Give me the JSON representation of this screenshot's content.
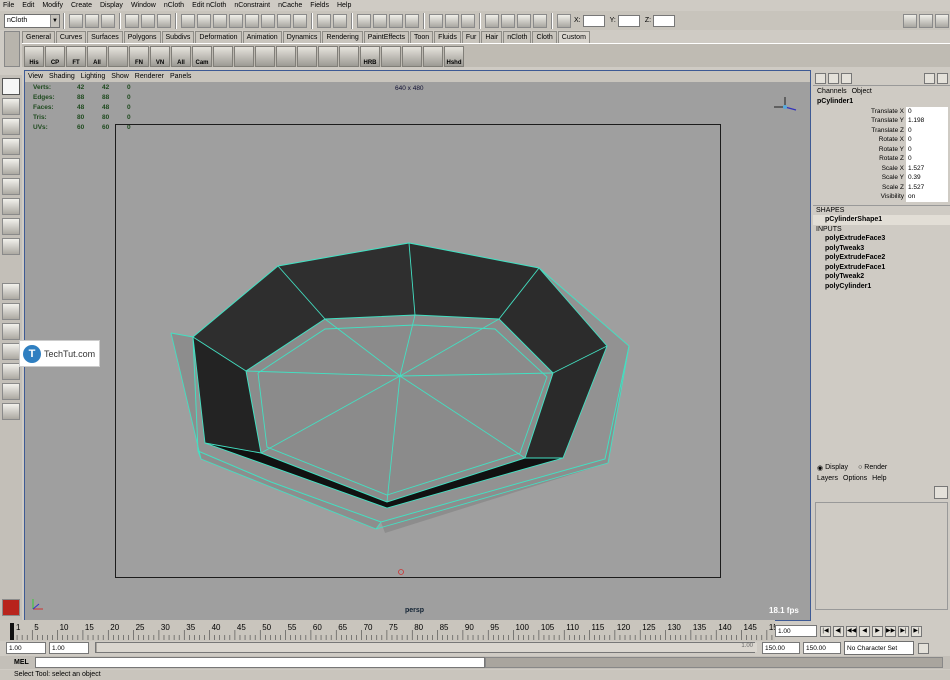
{
  "menubar": [
    "File",
    "Edit",
    "Modify",
    "Create",
    "Display",
    "Window",
    "nCloth",
    "Edit nCloth",
    "nConstraint",
    "nCache",
    "Fields",
    "Help"
  ],
  "statusline": {
    "menuset": "nCloth",
    "x_label": "X:",
    "y_label": "Y:",
    "z_label": "Z:"
  },
  "shelf": {
    "tabs": [
      "General",
      "Curves",
      "Surfaces",
      "Polygons",
      "Subdivs",
      "Deformation",
      "Animation",
      "Dynamics",
      "Rendering",
      "PaintEffects",
      "Toon",
      "Fluids",
      "Fur",
      "Hair",
      "nCloth",
      "Cloth",
      "Custom"
    ],
    "active_tab": "Custom",
    "buttons": [
      "His",
      "CP",
      "FT",
      "All",
      "",
      "FN",
      "VN",
      "All",
      "Cam",
      "",
      "",
      "",
      "",
      "",
      "",
      "",
      "HRB",
      "",
      "",
      "",
      "Hshd"
    ]
  },
  "viewport": {
    "menu": [
      "View",
      "Shading",
      "Lighting",
      "Show",
      "Renderer",
      "Panels"
    ],
    "hud": [
      {
        "label": "Verts:",
        "a": "42",
        "b": "42",
        "c": "0"
      },
      {
        "label": "Edges:",
        "a": "88",
        "b": "88",
        "c": "0"
      },
      {
        "label": "Faces:",
        "a": "48",
        "b": "48",
        "c": "0"
      },
      {
        "label": "Tris:",
        "a": "80",
        "b": "80",
        "c": "0"
      },
      {
        "label": "UVs:",
        "a": "60",
        "b": "60",
        "c": "0"
      }
    ],
    "resolution": "640 x 480",
    "camera": "persp",
    "fps": "18.1 fps",
    "wire_color": "#3ee0c0",
    "dark_face": "#2e2e2e",
    "light_face": "#8a8a8a"
  },
  "channel_box": {
    "tabs": [
      "Channels",
      "Object"
    ],
    "object": "pCylinder1",
    "attributes": [
      {
        "name": "Translate X",
        "value": "0"
      },
      {
        "name": "Translate Y",
        "value": "1.198"
      },
      {
        "name": "Translate Z",
        "value": "0"
      },
      {
        "name": "Rotate X",
        "value": "0"
      },
      {
        "name": "Rotate Y",
        "value": "0"
      },
      {
        "name": "Rotate Z",
        "value": "0"
      },
      {
        "name": "Scale X",
        "value": "1.527"
      },
      {
        "name": "Scale Y",
        "value": "0.39"
      },
      {
        "name": "Scale Z",
        "value": "1.527"
      },
      {
        "name": "Visibility",
        "value": "on"
      }
    ],
    "shapes_label": "SHAPES",
    "shape": "pCylinderShape1",
    "inputs_label": "INPUTS",
    "inputs": [
      "polyExtrudeFace3",
      "polyTweak3",
      "polyExtrudeFace2",
      "polyExtrudeFace1",
      "polyTweak2",
      "polyCylinder1"
    ]
  },
  "layer_editor": {
    "display": "Display",
    "render": "Render",
    "menu": [
      "Layers",
      "Options",
      "Help"
    ]
  },
  "timeslider": {
    "ticks": [
      "1",
      "5",
      "10",
      "15",
      "20",
      "25",
      "30",
      "35",
      "40",
      "45",
      "50",
      "55",
      "60",
      "65",
      "70",
      "75",
      "80",
      "85",
      "90",
      "95",
      "100",
      "105",
      "110",
      "115",
      "120",
      "125",
      "130",
      "135",
      "140",
      "145",
      "15"
    ],
    "current": "1.00",
    "playback": [
      "|◀",
      "◀|",
      "◀◀",
      "◀",
      "▶",
      "▶▶",
      "▶|",
      "▶|"
    ]
  },
  "range": {
    "start": "1.00",
    "min": "1.00",
    "thumb_text": "1.00",
    "end": "150.00",
    "max": "150.00",
    "character": "No Character Set"
  },
  "mel_label": "MEL",
  "help_text": "Select Tool: select an object",
  "watermark": {
    "logo": "T",
    "text": "TechTut.com"
  }
}
